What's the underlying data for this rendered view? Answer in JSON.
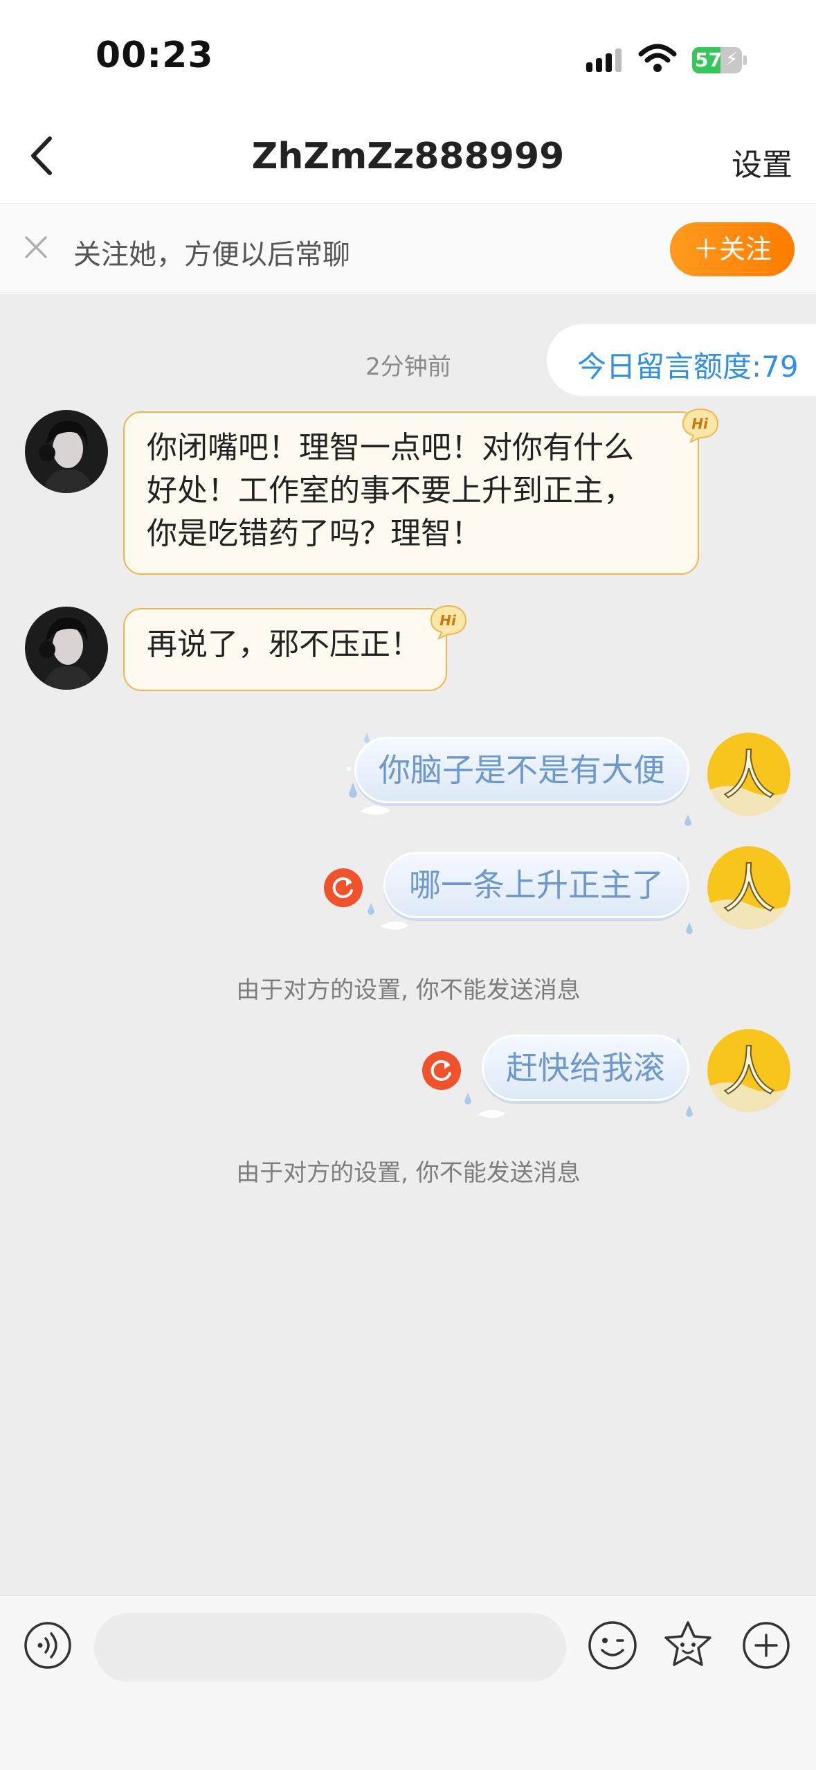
{
  "status_bar": {
    "time": "00:23",
    "battery": "57",
    "battery_level": 0.57
  },
  "nav": {
    "title": "ZhZmZz888999",
    "settings_label": "设置"
  },
  "follow_banner": {
    "text": "关注她，方便以后常聊",
    "follow_label": "＋关注"
  },
  "chat": {
    "timestamp": "2分钟前",
    "quota": "今日留言额度:79",
    "incoming": [
      {
        "lines": [
          "你闭嘴吧！理智一点吧！对你有什么",
          "好处！工作室的事不要上升到正主，",
          "你是吃错药了吗？理智！"
        ]
      },
      {
        "lines": [
          "再说了，邪不压正！"
        ]
      }
    ],
    "hi_badge_text": "Hi",
    "outgoing": [
      {
        "text": "你脑子是不是有大便"
      },
      {
        "text": "哪一条上升正主了"
      },
      {
        "text": "赶快给我滚"
      }
    ],
    "system_notices": [
      "由于对方的设置, 你不能发送消息",
      "由于对方的设置, 你不能发送消息"
    ],
    "avatar_outgoing_char": "人"
  },
  "input_bar": {
    "placeholder": ""
  },
  "colors": {
    "accent_orange": "#ff8a00",
    "quota_blue": "#2e90e8",
    "resend_red": "#f0522c",
    "bubble_blue_text": "#6b98cf"
  }
}
